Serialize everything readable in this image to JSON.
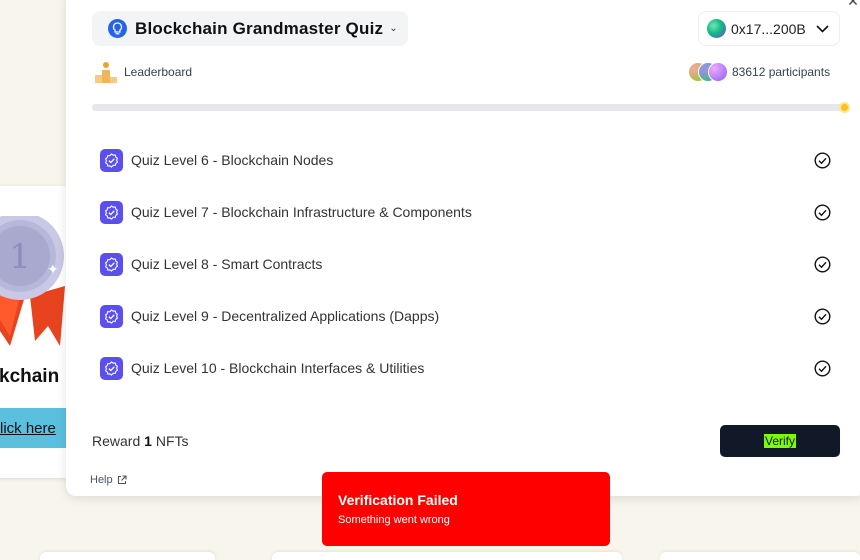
{
  "background_card": {
    "title_fragment": "kchain",
    "link_text": "lick here"
  },
  "quiz": {
    "title": "Blockchain Grandmaster Quiz"
  },
  "wallet": {
    "address": "0x17...200B"
  },
  "leaderboard": {
    "label": "Leaderboard"
  },
  "participants": {
    "text": "83612 participants"
  },
  "progress": {
    "fraction": 1.0
  },
  "levels": [
    {
      "label": "Quiz Level 6 - Blockchain Nodes",
      "completed": true
    },
    {
      "label": "Quiz Level 7 - Blockchain Infrastructure & Components",
      "completed": true
    },
    {
      "label": "Quiz Level 8 - Smart Contracts",
      "completed": true
    },
    {
      "label": "Quiz Level 9 - Decentralized Applications (Dapps)",
      "completed": true
    },
    {
      "label": "Quiz Level 10 - Blockchain Interfaces & Utilities",
      "completed": true
    }
  ],
  "reward": {
    "prefix": "Reward",
    "count": "1",
    "suffix": "NFTs"
  },
  "verify": {
    "label": "Verify"
  },
  "help": {
    "label": "Help"
  },
  "toast": {
    "title": "Verification Failed",
    "description": "Something went wrong"
  },
  "colors": {
    "accent": "#5b4ff0",
    "toast_bg": "#ff0000",
    "verify_bg": "#111827",
    "link_bg": "#5bc0de",
    "progress_knob": "#fbbf24"
  }
}
